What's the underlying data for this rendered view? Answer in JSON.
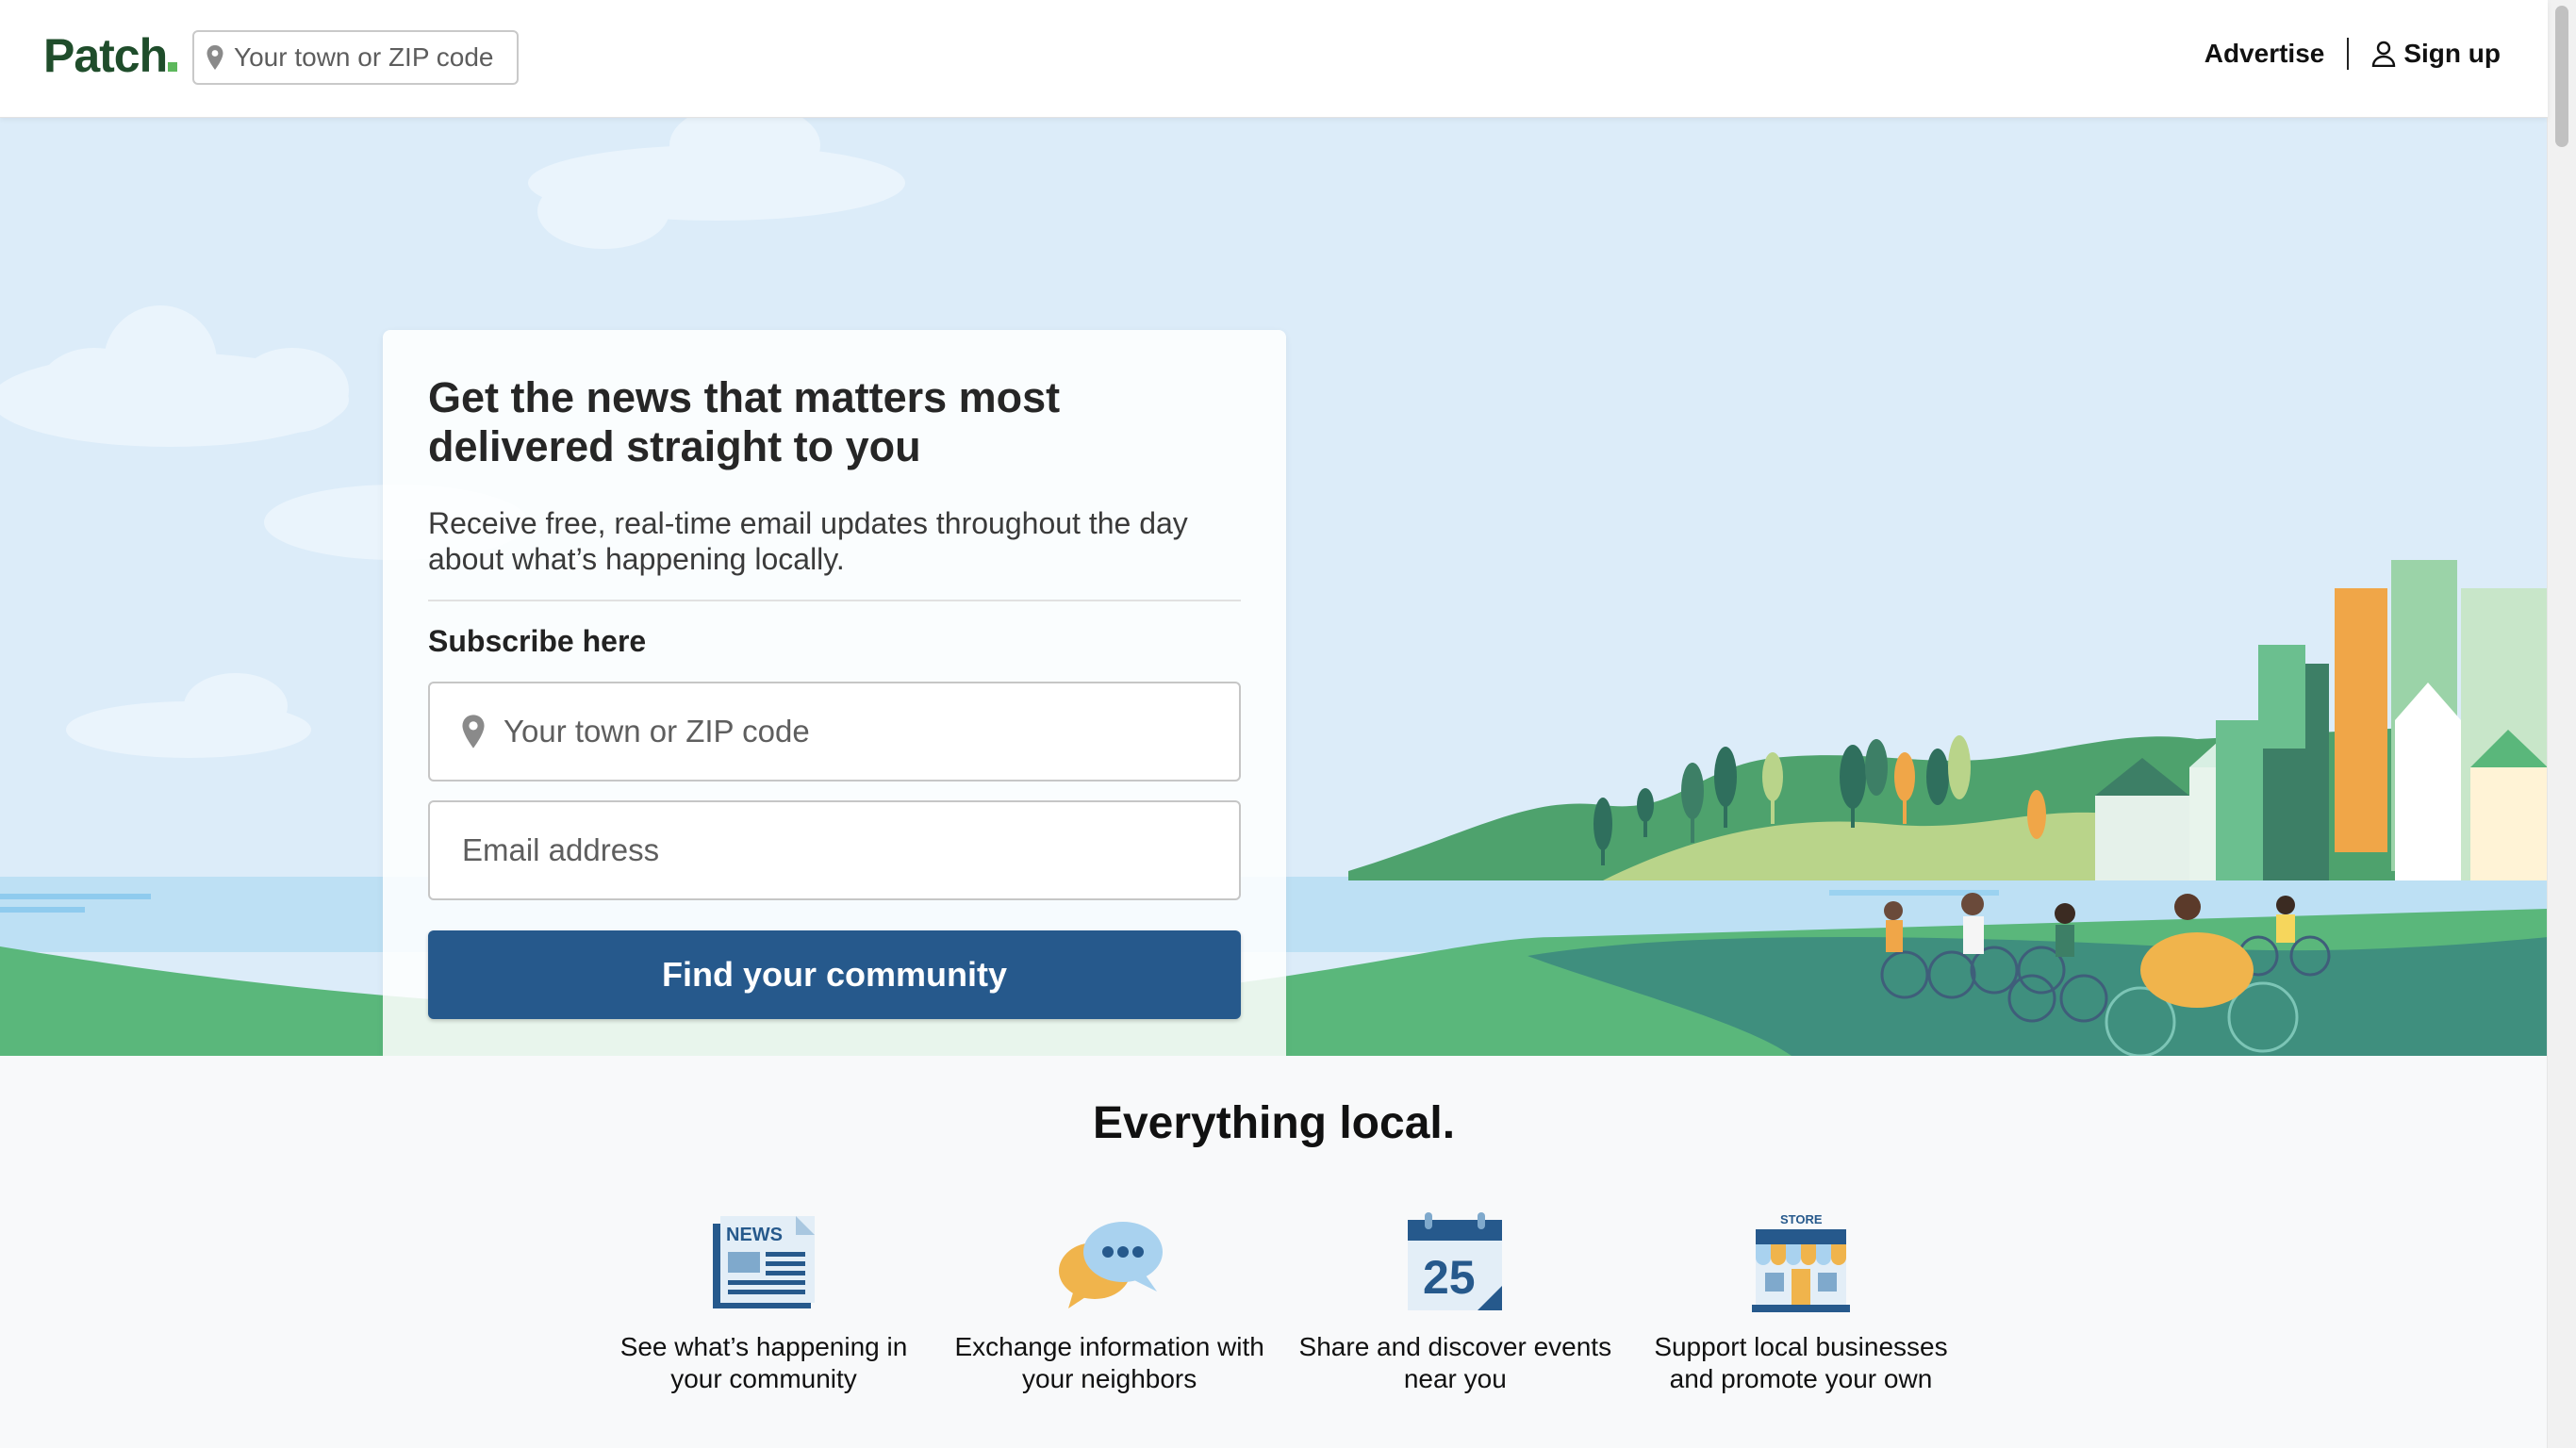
{
  "header": {
    "logo_text": "Patch",
    "search_placeholder": "Your town or ZIP code",
    "advertise_label": "Advertise",
    "signup_label": "Sign up"
  },
  "hero": {
    "title": "Get the news that matters most delivered straight to you",
    "lead": "Receive free, real-time email updates throughout the day about what’s happening locally.",
    "subscribe_label": "Subscribe here",
    "town_placeholder": "Your town or ZIP code",
    "email_placeholder": "Email address",
    "cta_label": "Find your community"
  },
  "features": {
    "title": "Everything local.",
    "items": [
      {
        "icon": "newspaper-icon",
        "badge": "NEWS",
        "text": "See what’s happening in your community"
      },
      {
        "icon": "chat-bubbles-icon",
        "text": "Exchange information with your neighbors"
      },
      {
        "icon": "calendar-icon",
        "badge": "25",
        "text": "Share and discover events near you"
      },
      {
        "icon": "storefront-icon",
        "badge": "STORE",
        "text": "Support local businesses and promote your own"
      }
    ]
  },
  "colors": {
    "brand_green": "#1f4d2b",
    "cta_blue": "#26598c",
    "sky": "#dcecf9",
    "grass": "#5ab77b",
    "water": "#bfe0f5"
  }
}
